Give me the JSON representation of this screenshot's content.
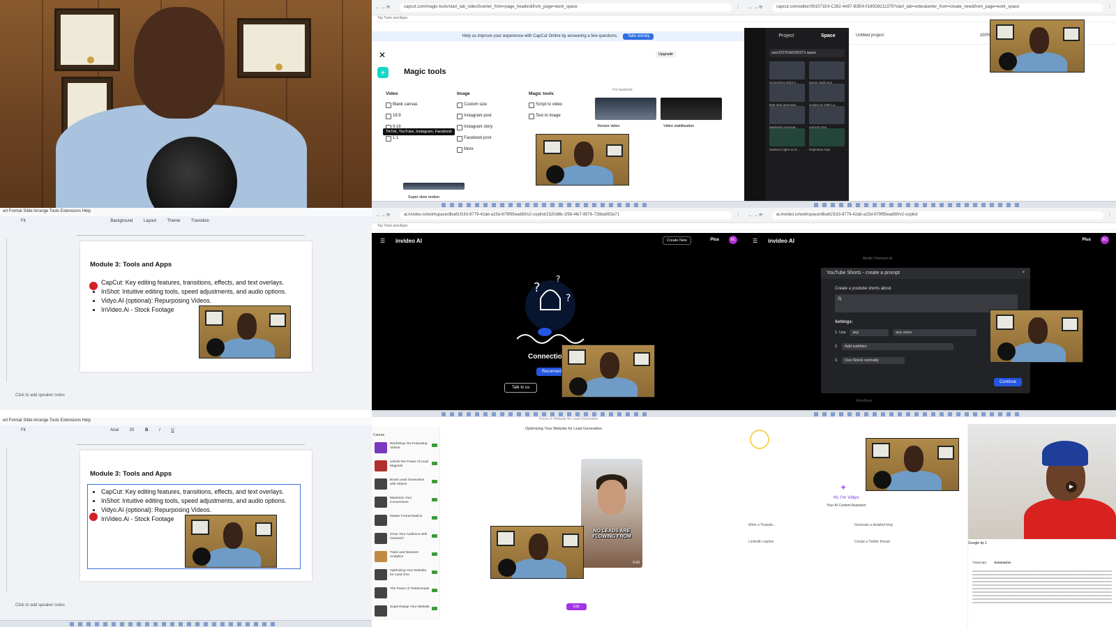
{
  "capcut_tools": {
    "url": "capcut.com/magic-tools/start_tab_videoScenter_from=page_header&from_page=work_space",
    "bookmark": "Top Tools and Apps",
    "banner_text": "Help us improve your experience with CapCut Online by answering a few questions.",
    "banner_button": "Take survey",
    "upgrade": "Upgrade",
    "title": "Magic tools",
    "video_header": "Video",
    "video_items": [
      "Blank canvas",
      "16:9",
      "9:16",
      "1:1"
    ],
    "image_header": "Image",
    "image_items": [
      "Custom size",
      "Instagram post",
      "Instagram story",
      "Facebook post",
      "More"
    ],
    "magic_header": "Magic tools",
    "magic_items": [
      "Script to video",
      "Text to image"
    ],
    "tooltip": "TikTok, YouTube, Instagram, Facebook",
    "for_business": "For business",
    "card1": "Resize video",
    "card2": "Video stabilization",
    "card3": "Super slow motion"
  },
  "capcut_editor": {
    "url": "capcut.com/editor/391071E4-C262-4A97-B3E4-0180D8211375?start_tab=video&enter_from=create_new&from_page=work_space",
    "tab_project": "Project",
    "tab_space": "Space",
    "space_name": "user2237616629237's space",
    "project_name": "Untitled project",
    "zoom": "100%",
    "media": [
      "Screenshot 2023-1...",
      "prayer-draft.mp4",
      "Added",
      "B2B lead generatio...",
      "invideo-ai-1080 Le...",
      "Marketing Automat...",
      "outro22.mp4",
      "Gaelo12 night run b...",
      "inspiration.mp4",
      ""
    ]
  },
  "slides_a": {
    "menu": "ert  Format  Slide  Arrange  Tools  Extensions  Help",
    "toolbar": [
      "Fit",
      "Background",
      "Layout",
      "Theme",
      "Transition"
    ],
    "title": "Module 3: Tools and Apps",
    "bullets": [
      "CapCut: Key editing features, transitions, effects, and text overlays.",
      "InShot: Intuitive editing tools, speed adjustments, and audio options.",
      "Vidyo.AI (optional): Repurposing Videos.",
      "InVideo.Ai - Stock Footage"
    ],
    "notes": "Click to add speaker notes",
    "share": "Share"
  },
  "invideo_a": {
    "url": "ai.invideo.io/workspace/dba61f163-8779-42ab-a15d-679f95ead80/v2-copilot/2320d6b-1f58-4fe7-9576-72bba063a71",
    "bookmark": "Top Tools and Apps",
    "logo": "invideo AI",
    "create_new": "Create New",
    "plus": "Plus",
    "avatar": "BC",
    "connection": "Connection",
    "reconnect": "Reconnect",
    "talk": "Talk to us"
  },
  "invideo_b": {
    "url": "ai.invideo.io/workspace/dba61f163-8779-42ab-a15d-679f95ead80/v2-copilot",
    "model": "Model: Premium AI",
    "modal_title": "YouTube Shorts - create a prompt",
    "modal_label": "Create a youtube shorts about",
    "prompt_value": "S|",
    "settings": "Settings:",
    "row1_label": "1. Use",
    "row1_a": "any",
    "row1_b": "any voice",
    "row2_label": "2.",
    "row2_a": "Add subtitles",
    "row3_label": "3.",
    "row3_a": "Use iStock normally",
    "continue": "Continue",
    "workflows": "Workflows"
  },
  "slides_b": {
    "menu": "ert  Format  Slide  Arrange  Tools  Extensions  Help",
    "toolbar": [
      "Fit",
      "Arial",
      "20",
      "B",
      "I",
      "U"
    ],
    "title": "Module 3: Tools and Apps",
    "bullets": [
      "CapCut: Key editing features, transitions, effects, and text overlays.",
      "InShot: Intuitive editing tools, speed adjustments, and audio options.",
      "Vidyo.AI (optional): Repurposing Videos.",
      "InVideo.Ai - Stock Footage"
    ],
    "notes": "Click to add speaker notes"
  },
  "learning": {
    "header": "Know-Ur Website for Lead Generation",
    "list_header": "Course",
    "video_title": "Optimizing Your Website for Lead Generation",
    "caption": "NO LEADS ARE FLOWING FROM",
    "duration": "0:43",
    "edit_pill": "Edit",
    "items": [
      "Workshop: Re-Purposing Videos",
      "Unlock the Power of Lead Magnets",
      "Boost Lead Generation with Videos",
      "Maximize Your Conversions",
      "Master Funnel Basics",
      "Grow Your Audience with Outreach",
      "Track and Measure Analytics",
      "Optimizing Your Website for Lead Gen",
      "The Power of Testimonials",
      "Supercharge Your Website"
    ]
  },
  "vidyo": {
    "greeting": "Hi, I'm Vidyo",
    "subtitle": "Your AI Content Assistant",
    "options": [
      "Write a Youtube...",
      "Generate a detailed blog",
      "LinkedIn caption",
      "Create a Twitter thread"
    ],
    "video_title": "Google tip 1",
    "tabs": [
      "Transcript",
      "Summarize"
    ]
  },
  "colors": {
    "capcut_accent": "#17d6c8",
    "invideo_blue": "#2456e0",
    "vidyo_purple": "#6a35e0",
    "record_red": "#d0202a"
  }
}
